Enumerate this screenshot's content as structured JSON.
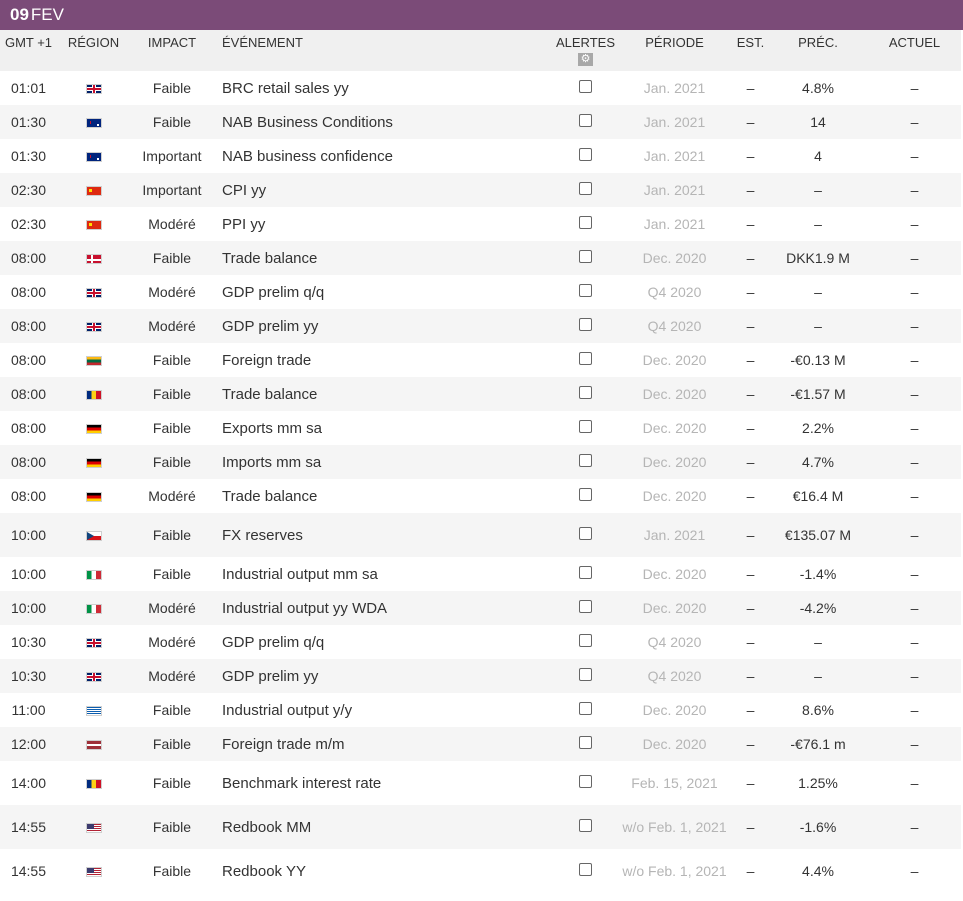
{
  "date": {
    "day": "09",
    "month": "FEV"
  },
  "headers": {
    "time": "GMT +1",
    "region": "RÉGION",
    "impact": "IMPACT",
    "event": "ÉVÉNEMENT",
    "alerts": "ALERTES",
    "period": "PÉRIODE",
    "est": "EST.",
    "prev": "PRÉC.",
    "actual": "ACTUEL",
    "settings_icon": "gear-icon"
  },
  "rows": [
    {
      "time": "01:01",
      "flag": "gb",
      "impact": "Faible",
      "event": "BRC retail sales yy",
      "period": "Jan. 2021",
      "est": "–",
      "prev": "4.8%",
      "actual": "–"
    },
    {
      "time": "01:30",
      "flag": "au",
      "impact": "Faible",
      "event": "NAB Business Conditions",
      "period": "Jan. 2021",
      "est": "–",
      "prev": "14",
      "actual": "–"
    },
    {
      "time": "01:30",
      "flag": "au",
      "impact": "Important",
      "event": "NAB business confidence",
      "period": "Jan. 2021",
      "est": "–",
      "prev": "4",
      "actual": "–"
    },
    {
      "time": "02:30",
      "flag": "cn",
      "impact": "Important",
      "event": "CPI yy",
      "period": "Jan. 2021",
      "est": "–",
      "prev": "–",
      "actual": "–"
    },
    {
      "time": "02:30",
      "flag": "cn",
      "impact": "Modéré",
      "event": "PPI yy",
      "period": "Jan. 2021",
      "est": "–",
      "prev": "–",
      "actual": "–"
    },
    {
      "time": "08:00",
      "flag": "dk",
      "impact": "Faible",
      "event": "Trade balance",
      "period": "Dec. 2020",
      "est": "–",
      "prev": "DKK1.9 M",
      "actual": "–"
    },
    {
      "time": "08:00",
      "flag": "gb",
      "impact": "Modéré",
      "event": "GDP prelim q/q",
      "period": "Q4 2020",
      "est": "–",
      "prev": "–",
      "actual": "–"
    },
    {
      "time": "08:00",
      "flag": "gb",
      "impact": "Modéré",
      "event": "GDP prelim yy",
      "period": "Q4 2020",
      "est": "–",
      "prev": "–",
      "actual": "–"
    },
    {
      "time": "08:00",
      "flag": "lt",
      "impact": "Faible",
      "event": "Foreign trade",
      "period": "Dec. 2020",
      "est": "–",
      "prev": "-€0.13 M",
      "actual": "–"
    },
    {
      "time": "08:00",
      "flag": "ro",
      "impact": "Faible",
      "event": "Trade balance",
      "period": "Dec. 2020",
      "est": "–",
      "prev": "-€1.57 M",
      "actual": "–"
    },
    {
      "time": "08:00",
      "flag": "de",
      "impact": "Faible",
      "event": "Exports mm sa",
      "period": "Dec. 2020",
      "est": "–",
      "prev": "2.2%",
      "actual": "–"
    },
    {
      "time": "08:00",
      "flag": "de",
      "impact": "Faible",
      "event": "Imports mm sa",
      "period": "Dec. 2020",
      "est": "–",
      "prev": "4.7%",
      "actual": "–"
    },
    {
      "time": "08:00",
      "flag": "de",
      "impact": "Modéré",
      "event": "Trade balance",
      "period": "Dec. 2020",
      "est": "–",
      "prev": "€16.4 M",
      "actual": "–"
    },
    {
      "time": "10:00",
      "flag": "cz",
      "impact": "Faible",
      "event": "FX reserves",
      "period": "Jan. 2021",
      "est": "–",
      "prev": "€135.07 M",
      "actual": "–",
      "tall": true
    },
    {
      "time": "10:00",
      "flag": "it",
      "impact": "Faible",
      "event": "Industrial output mm sa",
      "period": "Dec. 2020",
      "est": "–",
      "prev": "-1.4%",
      "actual": "–"
    },
    {
      "time": "10:00",
      "flag": "it",
      "impact": "Modéré",
      "event": "Industrial output yy WDA",
      "period": "Dec. 2020",
      "est": "–",
      "prev": "-4.2%",
      "actual": "–"
    },
    {
      "time": "10:30",
      "flag": "gb",
      "impact": "Modéré",
      "event": "GDP prelim q/q",
      "period": "Q4 2020",
      "est": "–",
      "prev": "–",
      "actual": "–"
    },
    {
      "time": "10:30",
      "flag": "gb",
      "impact": "Modéré",
      "event": "GDP prelim yy",
      "period": "Q4 2020",
      "est": "–",
      "prev": "–",
      "actual": "–"
    },
    {
      "time": "11:00",
      "flag": "gr",
      "impact": "Faible",
      "event": "Industrial output y/y",
      "period": "Dec. 2020",
      "est": "–",
      "prev": "8.6%",
      "actual": "–"
    },
    {
      "time": "12:00",
      "flag": "lv",
      "impact": "Faible",
      "event": "Foreign trade m/m",
      "period": "Dec. 2020",
      "est": "–",
      "prev": "-€76.1 m",
      "actual": "–"
    },
    {
      "time": "14:00",
      "flag": "ro",
      "impact": "Faible",
      "event": "Benchmark interest rate",
      "period": "Feb. 15, 2021",
      "est": "–",
      "prev": "1.25%",
      "actual": "–",
      "tall": true
    },
    {
      "time": "14:55",
      "flag": "us",
      "impact": "Faible",
      "event": "Redbook MM",
      "period": "w/o Feb. 1, 2021",
      "est": "–",
      "prev": "-1.6%",
      "actual": "–",
      "tall": true
    },
    {
      "time": "14:55",
      "flag": "us",
      "impact": "Faible",
      "event": "Redbook YY",
      "period": "w/o Feb. 1, 2021",
      "est": "–",
      "prev": "4.4%",
      "actual": "–",
      "tall": true
    }
  ]
}
